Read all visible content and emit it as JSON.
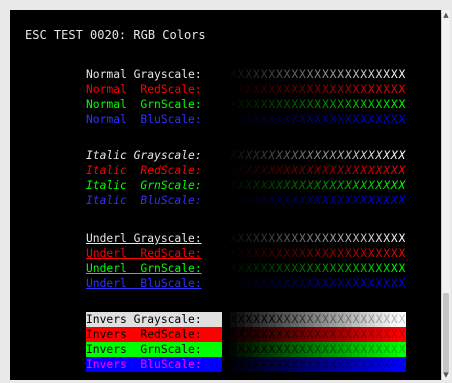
{
  "title": "ESC TEST 0020: RGB Colors",
  "groups": [
    {
      "style": "normal",
      "rows": [
        {
          "label": "Normal Grayscale:",
          "channel": "gray"
        },
        {
          "label": "Normal  RedScale:",
          "channel": "red"
        },
        {
          "label": "Normal  GrnScale:",
          "channel": "green"
        },
        {
          "label": "Normal  BluScale:",
          "channel": "blue"
        }
      ]
    },
    {
      "style": "italic",
      "rows": [
        {
          "label": "Italic Grayscale:",
          "channel": "gray"
        },
        {
          "label": "Italic  RedScale:",
          "channel": "red"
        },
        {
          "label": "Italic  GrnScale:",
          "channel": "green"
        },
        {
          "label": "Italic  BluScale:",
          "channel": "blue"
        }
      ]
    },
    {
      "style": "underl",
      "rows": [
        {
          "label": "Underl Grayscale:",
          "channel": "gray"
        },
        {
          "label": "Underl  RedScale:",
          "channel": "red"
        },
        {
          "label": "Underl  GrnScale:",
          "channel": "green"
        },
        {
          "label": "Underl  BluScale:",
          "channel": "blue"
        }
      ]
    },
    {
      "style": "invers",
      "rows": [
        {
          "label": "Invers Grayscale:",
          "channel": "gray"
        },
        {
          "label": "Invers  RedScale:",
          "channel": "red"
        },
        {
          "label": "Invers  GrnScale:",
          "channel": "green"
        },
        {
          "label": "Invers  BluScale:",
          "channel": "blue"
        }
      ]
    }
  ],
  "scale_text": "XXXXXXXXXXXXXXXXXXXXXXXX",
  "colors": {
    "gray": "#e6e6e6",
    "red": "#ff0000",
    "green": "#00ff00",
    "blue": "#0000ff",
    "background": "#000000",
    "chrome": "#e9e9e9"
  }
}
